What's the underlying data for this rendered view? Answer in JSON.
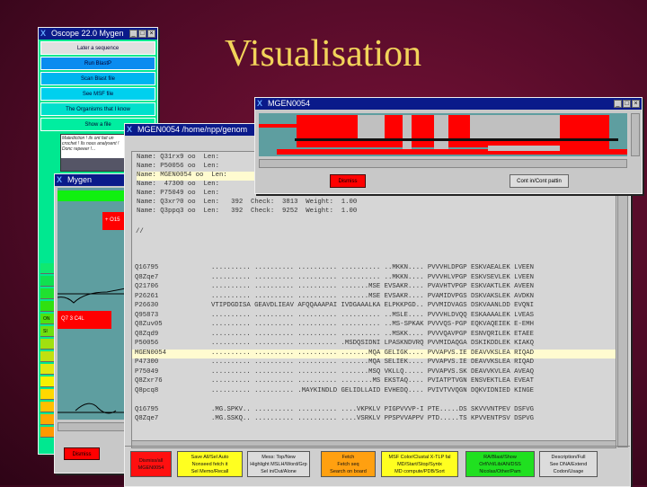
{
  "slide_title": "Visualisation",
  "oscope": {
    "title": "Oscope 22.0 Mygen",
    "buttons": [
      {
        "label": "Later a sequence",
        "color": "#e0e0e0"
      },
      {
        "label": "Run BlastP",
        "color": "#0a8cf0"
      },
      {
        "label": "Scan Blast file",
        "color": "#00b4f0"
      },
      {
        "label": "See MSF file",
        "color": "#00d0ee"
      },
      {
        "label": "The Organisms that I know",
        "color": "#00e0cc"
      },
      {
        "label": "Show a file",
        "color": "#00eea0"
      }
    ],
    "comic_text": "Malediction ! ils ont fait un crochet ! Ils nous analysent ! Donc repeeer !...",
    "strip_labels": [
      "ON",
      "SI"
    ]
  },
  "mygen": {
    "title": "Mygen",
    "label1": "+ O15",
    "label2": "Q7 3 C4L",
    "dismiss": "Dismiss"
  },
  "small_win": {
    "title": "MGEN0054",
    "dismiss": "Dismiss",
    "cont": "Cont in/Cont pattin"
  },
  "big_win": {
    "title": "MGEN0054  /home/npp/genom",
    "names": [
      "Name: Q31rx9 oo  Len:",
      "Name: P50056 oo  Len:",
      "Name: MGEN0054 oo  Len:",
      "Name:  47300 oo  Len:",
      "Name: P75049 oo  Len:",
      "Name: Q3xr?0 oo  Len:   392  Check:  3813  Weight:  1.00",
      "Name: Q3ppq3 oo  Len:   392  Check:  9252  Weight:  1.00"
    ],
    "separator": "//",
    "alignment": [
      {
        "id": "Q16795",
        "seq": ".......... .......... .......... .......... ..MKKN.... PVVVHLDPGP ESKVAEALEK LVEEN"
      },
      {
        "id": "Q8Zqe7",
        "seq": ".......... .......... .......... .......... ..MKKN.... PVVVHLVPGP ESKVSEVLEK LVEEN"
      },
      {
        "id": "Q21706",
        "seq": ".......... .......... .......... .......MSE EVSAKR.... PVAVHTVPGP ESKVAKTLEK AVEEN"
      },
      {
        "id": "P26261",
        "seq": ".......... .......... .......... .......MSE EVSAKR.... PVAMIDVPGS DSKVAKSLEK AVDKN"
      },
      {
        "id": "P26630",
        "seq": "VTIPDGDISA GEAVDLIEAV AFQQAAAPAI IVDGAAALKA ELPKKPGD.. PVVMIDVAGS DSKVAANLDD EVQNI"
      },
      {
        "id": "Q95873",
        "seq": ".......... .......... .......... .......... ..MSLE.... PVVVHLDVQQ ESKAAAALEK LVEAS"
      },
      {
        "id": "Q8Zuv05",
        "seq": ".......... .......... .......... .......... ..MS-SPKAK PVVVQS-PGP EQKVAQEIEK E-EMH"
      },
      {
        "id": "Q8Zqd9",
        "seq": ".......... .......... .......... .......... ..MSKK.... PVVVQAVPGP ESNVQRILEK ETAEE"
      },
      {
        "id": "P50056",
        "seq": ".......... .......... .......... .MSDQSIDNI LPASKNDVRQ PVVMIDAQGA DSKIKDDLEK KIAKQ"
      },
      {
        "id": "MGEN0054",
        "seq": ".......... .......... .......... .......MQA GELIGK.... PVVAPVS.IE DEAVVKSLEA RIQAD",
        "highlight": true
      },
      {
        "id": "P47300",
        "seq": ".......... .......... .......... .......MQA SELIEK.... PVVAPVS.IE DEAVVKSLEA RIQAD"
      },
      {
        "id": "P75049",
        "seq": ".......... .......... .......... .......MSQ VKLLQ..... PVVAPVS.SK DEAVVKVLEA AVEAQ"
      },
      {
        "id": "Q8Zxr76",
        "seq": ".......... .......... .......... ........MS EKSTAQ.... PVIATPTVGN ENSVEKTLEA EVEAT"
      },
      {
        "id": "Q8pcq8",
        "seq": ".......... .......... .MAYKINDLD GELIDLLAID EVHEDQ.... PVIVTVVQGN DQKVIDNIED KINGE"
      },
      {
        "id": "",
        "seq": ""
      },
      {
        "id": "Q16795",
        "seq": ".MG.SPKV.. .......... .......... ....VKPKLV PIGPVVVP-I PTE.....DS SKVVVNTPEV DSFVG"
      },
      {
        "id": "Q8Zqe7",
        "seq": ".MG.SSKQ.. .......... .......... ....VSRKLV PPSPVVAPPV PTD.....TS KPVVENTPSV DSPVG"
      }
    ],
    "buttons": [
      {
        "lines": [
          "Dismiss/all",
          "MGEN0054"
        ],
        "color": "#ff1010"
      },
      {
        "lines": [
          "Save All/Sel Auto",
          "Nonseed fetch it",
          "Sel Memo/Recall"
        ],
        "color": "#ffff20"
      },
      {
        "lines": [
          "Mess: Top/New",
          "Highlight MSLH/Word/Grp",
          "Sel in/Out/Alone"
        ],
        "color": "#dcdcdc"
      },
      {
        "lines": [
          "Fetch",
          "Fetch seq",
          "Search on board"
        ],
        "color": "#ffa010"
      },
      {
        "lines": [
          "MSF Color/Clustal X-TLP fal",
          "MD/Start/Stop/Syntx",
          "MD compute/PDB/Sort"
        ],
        "color": "#ffff20"
      },
      {
        "lines": [
          "RA/Blast/Show",
          "Orf/Vrl/Lib/AN/DSS",
          "Nicolas/Other/Pam"
        ],
        "color": "#20e020"
      },
      {
        "lines": [
          "Description/Full",
          "See DNA/Extend",
          "Codon/Usage"
        ],
        "color": "#dcdcdc"
      }
    ]
  }
}
